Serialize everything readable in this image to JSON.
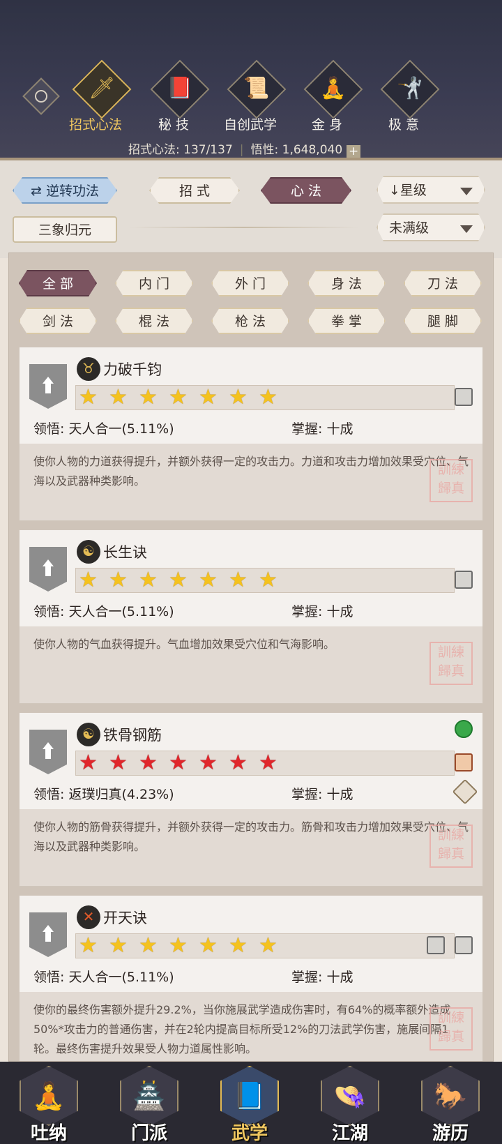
{
  "header": {
    "tabs": [
      {
        "label": "招式心法",
        "icon": "sword-icon",
        "active": true
      },
      {
        "label": "秘 技",
        "icon": "book-icon",
        "active": false
      },
      {
        "label": "自创武学",
        "icon": "scroll-icon",
        "active": false
      },
      {
        "label": "金 身",
        "icon": "meditation-icon",
        "active": false
      },
      {
        "label": "极 意",
        "icon": "stance-icon",
        "active": false
      }
    ],
    "stat_label": "招式心法: 137/137",
    "wuxing_label": "悟性: 1,648,040",
    "plus": "+"
  },
  "filter": {
    "reverse": "逆转功法",
    "zhaoshi": "招 式",
    "xinfa": "心 法",
    "sort": "星级",
    "sanxiang": "三象归元",
    "level": "未满级"
  },
  "categories": [
    "全 部",
    "内 门",
    "外 门",
    "身 法",
    "刀 法",
    "剑 法",
    "棍 法",
    "枪 法",
    "拳 掌",
    "腿 脚"
  ],
  "cards": [
    {
      "name": "力破千钧",
      "stars": 7,
      "star_color": "gold",
      "lingwu": "领悟: 天人合一(5.11%)",
      "zhangwo": "掌握: 十成",
      "desc": "使你人物的力道获得提升，并额外获得一定的攻击力。力道和攻击力增加效果受穴位、气海以及武器种类影响。",
      "icon": "bull-icon",
      "seal": "訓練歸真"
    },
    {
      "name": "长生诀",
      "stars": 7,
      "star_color": "gold",
      "lingwu": "领悟: 天人合一(5.11%)",
      "zhangwo": "掌握: 十成",
      "desc": "使你人物的气血获得提升。气血增加效果受穴位和气海影响。",
      "icon": "yinyang-icon",
      "seal": "訓練歸真"
    },
    {
      "name": "铁骨钢筋",
      "stars": 7,
      "star_color": "red",
      "lingwu": "领悟: 返璞归真(4.23%)",
      "zhangwo": "掌握: 十成",
      "desc": "使你人物的筋骨获得提升，并额外获得一定的攻击力。筋骨和攻击力增加效果受穴位、气海以及武器种类影响。",
      "icon": "yinyang-icon",
      "seal": "訓練歸真"
    },
    {
      "name": "开天诀",
      "stars": 7,
      "star_color": "gold",
      "lingwu": "领悟: 天人合一(5.11%)",
      "zhangwo": "掌握: 十成",
      "desc": "使你的最终伤害额外提升29.2%，当你施展武学造成伤害时，有64%的概率额外造成50%*攻击力的普通伤害，并在2轮内提高目标所受12%的刀法武学伤害，施展间隔1轮。最终伤害提升效果受人物力道属性影响。",
      "icon": "axe-icon",
      "seal": "訓練歸真"
    }
  ],
  "nav": [
    {
      "label": "吐纳",
      "icon": "monk-icon",
      "active": false
    },
    {
      "label": "门派",
      "icon": "sect-icon",
      "active": false
    },
    {
      "label": "武学",
      "icon": "manual-icon",
      "active": true
    },
    {
      "label": "江湖",
      "icon": "hat-icon",
      "active": false
    },
    {
      "label": "游历",
      "icon": "horse-icon",
      "active": false
    }
  ]
}
